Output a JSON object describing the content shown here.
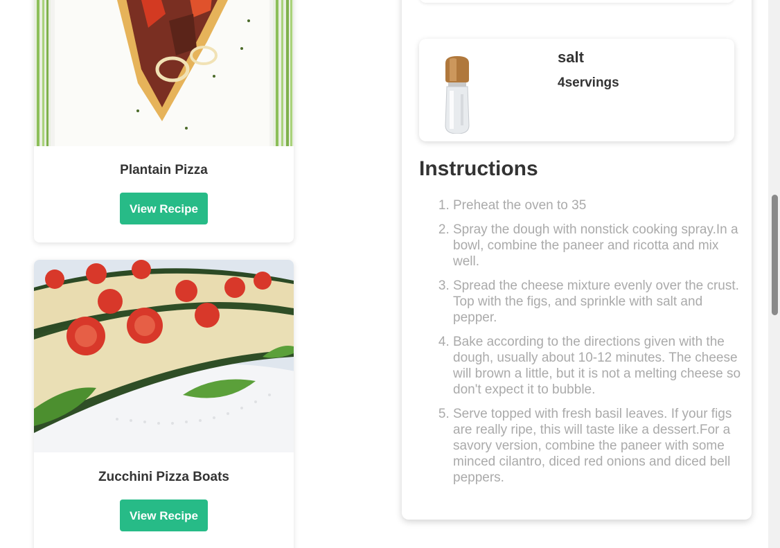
{
  "recipes": [
    {
      "title": "Plantain Pizza",
      "button_label": "View Recipe",
      "image": "plantain-pizza-photo"
    },
    {
      "title": "Zucchini Pizza Boats",
      "button_label": "View Recipe",
      "image": "zucchini-pizza-boats-photo"
    }
  ],
  "detail": {
    "ingredient": {
      "name": "salt",
      "amount": "4servings",
      "image": "salt-shaker-photo"
    },
    "instructions_heading": "Instructions",
    "instructions": [
      "Preheat the oven to 35",
      "Spray the dough with nonstick cooking spray.In a bowl, combine the paneer and ricotta and mix well.",
      "Spread the cheese mixture evenly over the crust. Top with the figs, and sprinkle with salt and pepper.",
      "Bake according to the directions given with the dough, usually about 10-12 minutes. The cheese will brown a little, but it is not a melting cheese so don't expect it to bubble.",
      "Serve topped with fresh basil leaves. If your figs are really ripe, this will taste like a dessert.For a savory version, combine the paneer with some minced cilantro, diced red onions and diced bell peppers."
    ]
  },
  "colors": {
    "accent": "#27bb87",
    "text": "#333333",
    "muted": "#aaaaaa"
  }
}
